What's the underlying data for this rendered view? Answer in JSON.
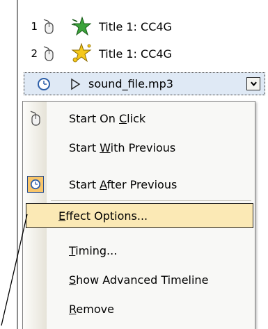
{
  "animation_list": {
    "items": [
      {
        "number": "1",
        "label": "Title 1: CC4G",
        "icon": "green-star-icon"
      },
      {
        "number": "2",
        "label": "Title 1: CC4G",
        "icon": "gold-star-burst-icon"
      }
    ],
    "selected": {
      "label": "sound_file.mp3",
      "icon": "play-triangle-icon",
      "trigger_icon": "clock-icon",
      "dropdown_icon": "chevron-down-icon"
    }
  },
  "context_menu": {
    "items": [
      {
        "pre": "Start On ",
        "key": "C",
        "post": "lick",
        "icon": "mouse-icon"
      },
      {
        "pre": "Start ",
        "key": "W",
        "post": "ith Previous",
        "icon": ""
      },
      {
        "pre": "Start ",
        "key": "A",
        "post": "fter Previous",
        "icon": "clock-icon",
        "checked": true
      },
      {
        "pre": "",
        "key": "E",
        "post": "ffect Options...",
        "highlighted": true
      },
      {
        "pre": "",
        "key": "T",
        "post": "iming..."
      },
      {
        "pre": "",
        "key": "S",
        "post": "how Advanced Timeline"
      },
      {
        "pre": "",
        "key": "R",
        "post": "emove"
      }
    ]
  },
  "colors": {
    "highlight": "#fbe9b5",
    "checked_bg": "#f9c66a",
    "selected_row": "#dfe9f5",
    "gutter": "#e6e3d8"
  }
}
